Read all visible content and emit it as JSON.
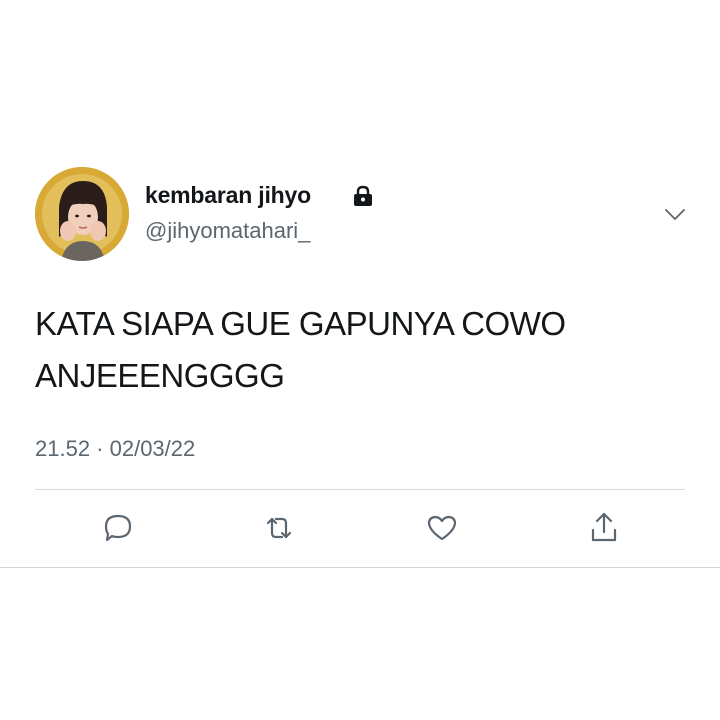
{
  "tweet": {
    "display_name": "kembaran jihyo",
    "handle": "@jihyomatahari_",
    "text_line1": "KATA SIAPA GUE GAPUNYA COWO",
    "text_line2": "ANJEEENGGGG",
    "timestamp": "21.52 · 02/03/22",
    "protected_icon": "lock-icon",
    "menu_icon": "chevron-down-icon"
  },
  "actions": [
    {
      "name": "reply",
      "icon": "comment-bubble-icon"
    },
    {
      "name": "retweet",
      "icon": "retweet-icon"
    },
    {
      "name": "like",
      "icon": "heart-icon"
    },
    {
      "name": "share",
      "icon": "share-icon"
    }
  ],
  "colors": {
    "text": "#14171a",
    "secondary_text": "#5b6670",
    "divider": "#d5dbe0",
    "icon": "#5b6670"
  }
}
